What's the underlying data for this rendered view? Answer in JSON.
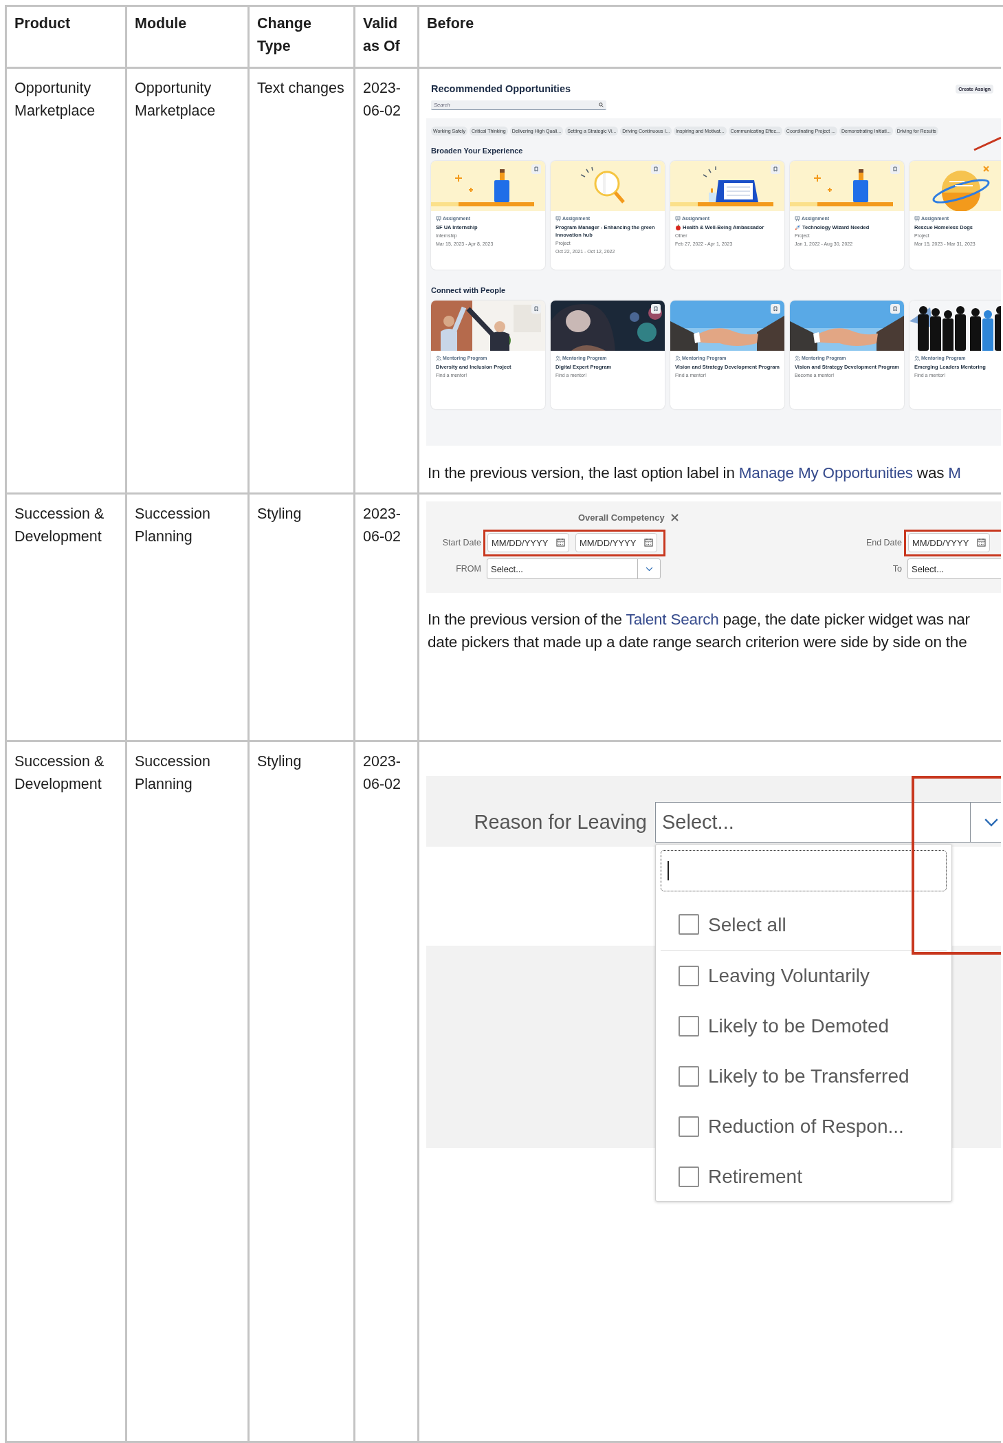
{
  "columns": [
    "Product",
    "Module",
    "Change Type",
    "Valid as Of",
    "Before"
  ],
  "rows": [
    {
      "product": "Opportunity Marketplace",
      "module": "Opportunity Marketplace",
      "change_type": "Text changes",
      "valid_as_of": "2023-06-02",
      "before": {
        "kind": "opportunities",
        "title": "Recommended Opportunities",
        "action_button": "Create Assign",
        "search": {
          "placeholder": "Search"
        },
        "chips": [
          "Working Safely",
          "Critical Thinking",
          "Delivering High Quali...",
          "Setting a Strategic Vi...",
          "Driving Continuous I...",
          "Inspiring and Motivat...",
          "Communicating Effec...",
          "Coordinating Project ...",
          "Demonstrating Initiati...",
          "Driving for Results"
        ],
        "sections": [
          {
            "heading": "Broaden Your Experience",
            "cards": [
              {
                "kind": "assignment",
                "art": {
                  "kind": "pencil-cup"
                },
                "bookmark": true,
                "type": "Assignment",
                "title": "SF UA Internship",
                "category": "Internship",
                "dates": "Mar 15, 2023 - Apr 8, 2023"
              },
              {
                "kind": "assignment",
                "art": {
                  "kind": "magnifier"
                },
                "bookmark": true,
                "type": "Assignment",
                "title": "Program Manager - Enhancing the green innovation hub",
                "category": "Project",
                "dates": "Oct 22, 2021 - Oct 12, 2022"
              },
              {
                "kind": "assignment",
                "art": {
                  "kind": "calendar"
                },
                "bookmark": true,
                "badge": {
                  "kind": "apple"
                },
                "type": "Assignment",
                "title": "Health & Well-Being Ambassador",
                "category": "Other",
                "dates": "Feb 27, 2022 - Apr 1, 2023"
              },
              {
                "kind": "assignment",
                "art": {
                  "kind": "pencil-cup"
                },
                "bookmark": true,
                "badge": {
                  "kind": "rocket"
                },
                "type": "Assignment",
                "title": "Technology Wizard Needed",
                "category": "Project",
                "dates": "Jan 1, 2022 - Aug 30, 2022"
              },
              {
                "kind": "assignment",
                "art": {
                  "kind": "planet"
                },
                "bookmark": false,
                "type": "Assignment",
                "title": "Rescue Homeless Dogs",
                "category": "Project",
                "dates": "Mar 15, 2023 - Mar 31, 2023"
              }
            ]
          },
          {
            "heading": "Connect with People",
            "cards": [
              {
                "kind": "mentoring",
                "bookmark": true,
                "type": "Mentoring Program",
                "title": "Diversity and Inclusion Project",
                "note": "Find a mentor!"
              },
              {
                "kind": "mentoring",
                "bookmark": true,
                "type": "Mentoring Program",
                "title": "Digital Expert Program",
                "note": "Find a mentor!"
              },
              {
                "kind": "mentoring",
                "bookmark": true,
                "type": "Mentoring Program",
                "title": "Vision and Strategy Development Program",
                "note": "Find a mentor!"
              },
              {
                "kind": "mentoring",
                "bookmark": true,
                "type": "Mentoring Program",
                "title": "Vision and Strategy Development Program",
                "note": "Become a mentor!"
              },
              {
                "kind": "mentoring",
                "bookmark": false,
                "type": "Mentoring Program",
                "title": "Emerging Leaders Mentoring",
                "note": "Find a mentor!"
              }
            ]
          }
        ],
        "description": [
          [
            {
              "text": "In the previous version, the last option label in "
            },
            {
              "text": "Manage My Opportunities",
              "link": true
            },
            {
              "text": " was "
            },
            {
              "text": "M",
              "link": true
            }
          ]
        ]
      }
    },
    {
      "product": "Succession & Development",
      "module": "Succession Planning",
      "change_type": "Styling",
      "valid_as_of": "2023-06-02",
      "before": {
        "kind": "date-range",
        "heading": "Overall Competency",
        "start": {
          "label": "Start Date",
          "highlighted": true,
          "fields": [
            {
              "placeholder": "MM/DD/YYYY"
            },
            {
              "placeholder": "MM/DD/YYYY"
            }
          ],
          "select_label": "FROM",
          "select_value": "Select..."
        },
        "end": {
          "label": "End Date",
          "highlighted": true,
          "fields": [
            {
              "placeholder": "MM/DD/YYYY"
            }
          ],
          "select_label": "To",
          "select_value": "Select..."
        },
        "description": [
          [
            {
              "text": "In the previous version of the "
            },
            {
              "text": "Talent Search",
              "link": true
            },
            {
              "text": " page, the date picker widget was nar"
            }
          ],
          [
            {
              "text": "date pickers that made up a date range search criterion were side by side on the"
            }
          ]
        ]
      }
    },
    {
      "product": "Succession & Development",
      "module": "Succession Planning",
      "change_type": "Styling",
      "valid_as_of": "2023-06-02",
      "before": {
        "kind": "multi-select",
        "label": "Reason for Leaving",
        "value": "Select...",
        "highlighted": true,
        "options": [
          {
            "label": "Select all",
            "checked": false
          },
          {
            "label": "Leaving Voluntarily",
            "checked": false
          },
          {
            "label": "Likely to be Demoted",
            "checked": false
          },
          {
            "label": "Likely to be Transferred",
            "checked": false
          },
          {
            "label": "Reduction of Respon...",
            "checked": false
          },
          {
            "label": "Retirement",
            "checked": false
          }
        ]
      }
    }
  ]
}
